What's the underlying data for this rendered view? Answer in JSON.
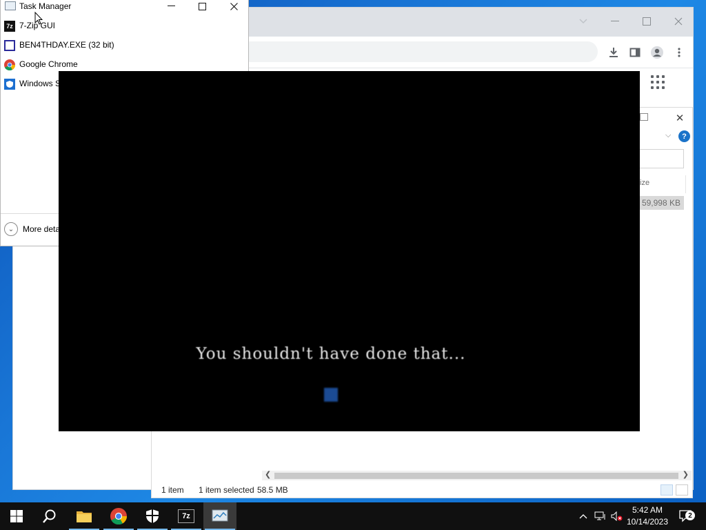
{
  "task_manager": {
    "title": "Task Manager",
    "apps": [
      {
        "label": "7-Zip GUI",
        "icon": "7zip-icon"
      },
      {
        "label": "BEN4THDAY.EXE (32 bit)",
        "icon": "window-app-icon"
      },
      {
        "label": "Google Chrome",
        "icon": "chrome-icon"
      },
      {
        "label": "Windows S",
        "icon": "windows-security-icon"
      }
    ],
    "more_details": "More deta"
  },
  "zip_window": {
    "column_size_header": "ize",
    "row_size": "59,998 KB",
    "status": {
      "items": "1 item",
      "selected": "1 item selected",
      "size": "58.5 MB"
    }
  },
  "game": {
    "message": "You shouldn't have done that..."
  },
  "taskbar": {
    "clock_time": "5:42 AM",
    "clock_date": "10/14/2023",
    "notifications_count": "2"
  }
}
